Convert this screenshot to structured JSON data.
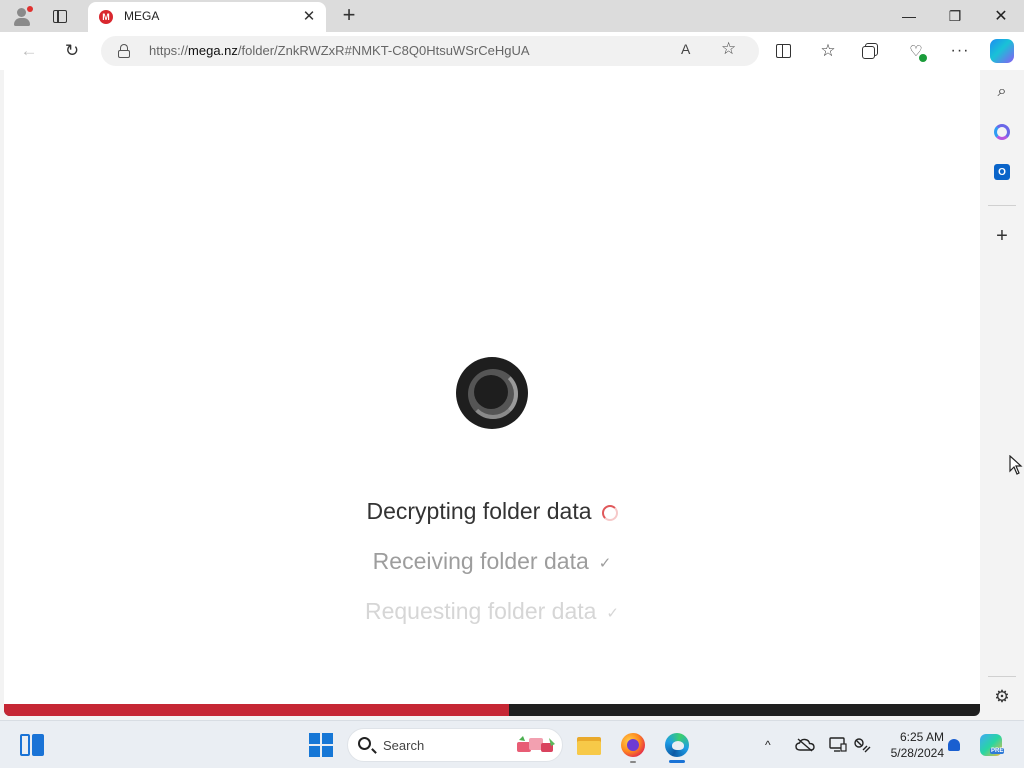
{
  "tab": {
    "title": "MEGA",
    "favicon_letter": "M",
    "close": "✕"
  },
  "newtab": "+",
  "window": {
    "minimize": "—",
    "restore": "❐",
    "close": "✕"
  },
  "address": {
    "prefix": "https://",
    "domain": "mega.nz",
    "path": "/folder/ZnkRWZxR#NMKT-C8Q0HtsuWSrCeHgUA"
  },
  "toolbar": {
    "back": "←",
    "reload": "↻",
    "read_aloud": "A",
    "favorite": "☆",
    "favorites": "☆",
    "more": "···",
    "health": "♡"
  },
  "loading": {
    "steps": [
      {
        "label": "Decrypting folder data",
        "status": "in-progress"
      },
      {
        "label": "Receiving folder data",
        "status": "done",
        "mark": "✓"
      },
      {
        "label": "Requesting folder data",
        "status": "done",
        "mark": "✓"
      }
    ],
    "progress_fraction": 0.517
  },
  "sidebar": {
    "search": "⌕",
    "add": "+",
    "settings": "⚙",
    "outlook_letter": "O"
  },
  "taskbar": {
    "search_label": "Search",
    "tray_chevron": "^",
    "time": "6:25 AM",
    "date": "5/28/2024",
    "copilot_badge": "PRE"
  },
  "colors": {
    "mega_red": "#d9272e",
    "progress_fill": "#c62734",
    "progress_track": "#1f1f1f",
    "accent": "#1a73d6"
  }
}
